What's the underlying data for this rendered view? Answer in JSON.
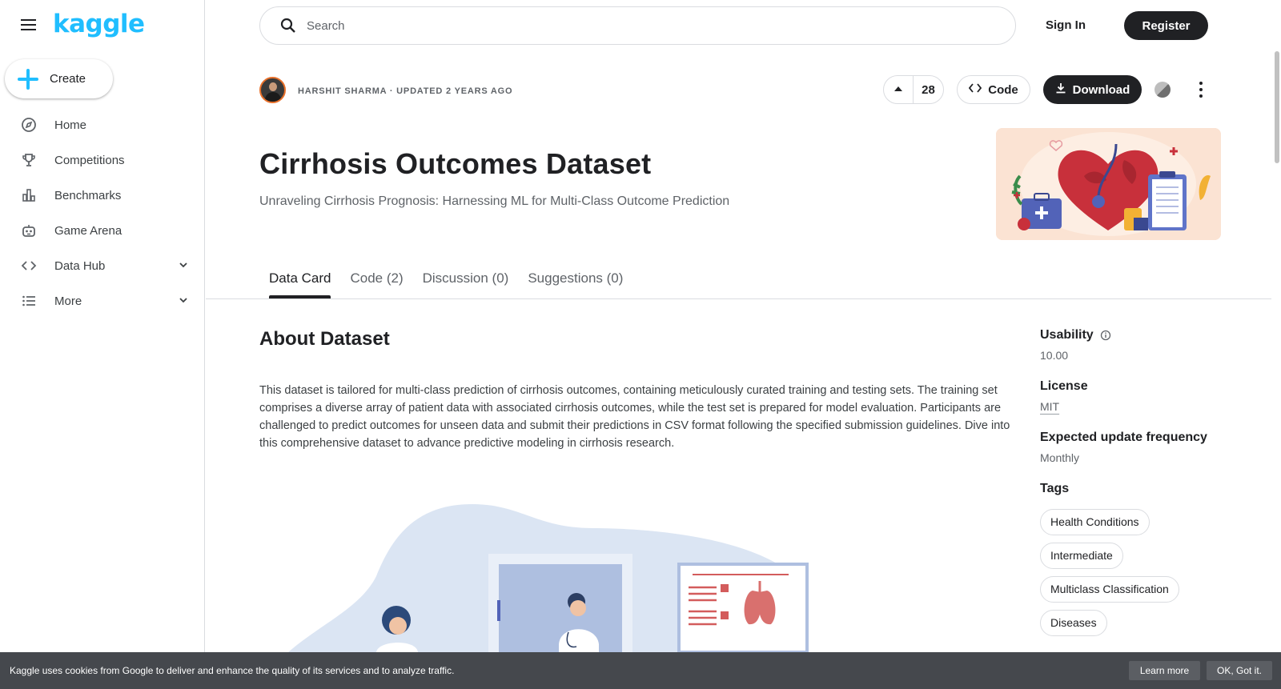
{
  "brand": {
    "logo_text": "kaggle",
    "accent": "#20beff"
  },
  "sidebar": {
    "create_label": "Create",
    "items": [
      {
        "label": "Home",
        "icon": "compass-icon"
      },
      {
        "label": "Competitions",
        "icon": "trophy-icon"
      },
      {
        "label": "Benchmarks",
        "icon": "bar-chart-icon"
      },
      {
        "label": "Game Arena",
        "icon": "robot-icon"
      },
      {
        "label": "Data Hub",
        "icon": "code-brackets-icon",
        "expandable": true
      },
      {
        "label": "More",
        "icon": "list-icon",
        "expandable": true
      }
    ]
  },
  "header": {
    "search_placeholder": "Search",
    "signin_label": "Sign In",
    "register_label": "Register"
  },
  "dataset": {
    "author_line": "HARSHIT SHARMA · UPDATED 2 YEARS AGO",
    "upvotes": "28",
    "code_label": "Code",
    "download_label": "Download",
    "title": "Cirrhosis Outcomes Dataset",
    "subtitle": "Unraveling Cirrhosis Prognosis: Harnessing ML for Multi-Class Outcome Prediction"
  },
  "tabs": [
    {
      "label": "Data Card",
      "active": true
    },
    {
      "label": "Code (2)",
      "active": false
    },
    {
      "label": "Discussion (0)",
      "active": false
    },
    {
      "label": "Suggestions (0)",
      "active": false
    }
  ],
  "about": {
    "heading": "About Dataset",
    "body": "This dataset is tailored for multi-class prediction of cirrhosis outcomes, containing meticulously curated training and testing sets. The training set comprises a diverse array of patient data with associated cirrhosis outcomes, while the test set is prepared for model evaluation. Participants are challenged to predict outcomes for unseen data and submit their predictions in CSV format following the specified submission guidelines. Dive into this comprehensive dataset to advance predictive modeling in cirrhosis research."
  },
  "meta": {
    "usability_label": "Usability",
    "usability_value": "10.00",
    "license_label": "License",
    "license_value": "MIT",
    "frequency_label": "Expected update frequency",
    "frequency_value": "Monthly",
    "tags_label": "Tags",
    "tags": [
      "Health Conditions",
      "Intermediate",
      "Multiclass Classification",
      "Diseases"
    ]
  },
  "cookie": {
    "message": "Kaggle uses cookies from Google to deliver and enhance the quality of its services and to analyze traffic.",
    "learn_more": "Learn more",
    "ok": "OK, Got it."
  }
}
